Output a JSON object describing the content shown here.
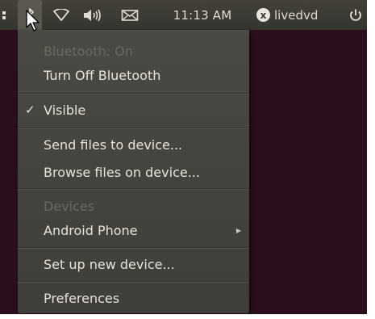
{
  "panel": {
    "clock": "11:13 AM",
    "user_name": "livedvd",
    "user_badge": "x",
    "icons": [
      "bluetooth-icon",
      "network-wifi-icon",
      "volume-icon",
      "mail-icon",
      "power-icon"
    ]
  },
  "menu": {
    "status": "Bluetooth: On",
    "turn_off": "Turn Off Bluetooth",
    "visible": "Visible",
    "visible_check": "✓",
    "send_files": "Send files to device...",
    "browse_files": "Browse files on device...",
    "devices_header": "Devices",
    "android_phone": "Android Phone",
    "setup_device": "Set up new device...",
    "preferences": "Preferences"
  },
  "colors": {
    "panel_bg": "#3b3a34",
    "menu_bg": "#45443e",
    "text": "#e8e4dc",
    "disabled_text": "#6a6860",
    "desktop": "#2c0f1f"
  }
}
